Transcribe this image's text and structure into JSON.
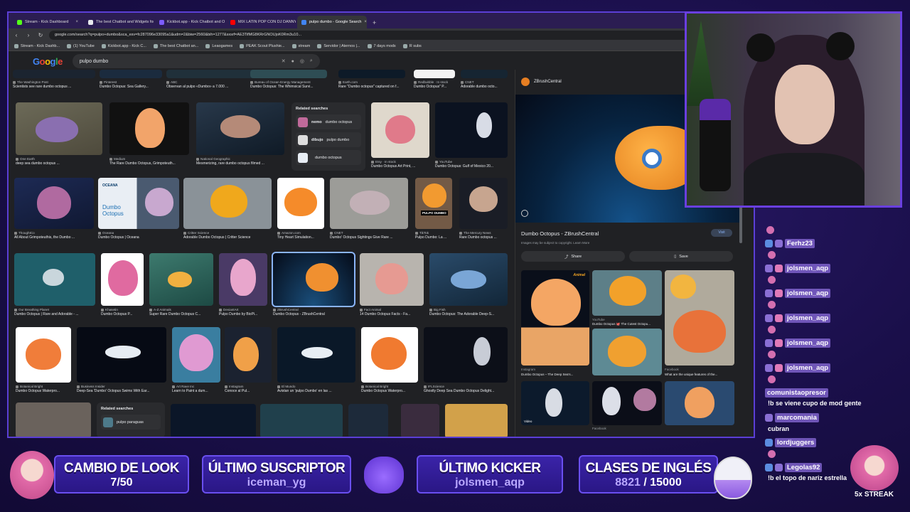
{
  "browser": {
    "tabs": [
      {
        "label": "Stream - Kick Dashboard",
        "color": "#53fc18"
      },
      {
        "label": "The best Chatbot and Widgets for Ki",
        "color": "#e8eaed"
      },
      {
        "label": "Kickbot.app - Kick Chatbot and Overl",
        "color": "#7c5cff"
      },
      {
        "label": "MIX LATIN POP CON DJ DANNY",
        "color": "#ff0000"
      },
      {
        "label": "pulpo dumbo - Google Search",
        "color": "#4285f4",
        "active": true
      }
    ],
    "new_tab": "+",
    "address": "google.com/search?q=pulpo+dumbo&sca_esv=fc287096e33095a1&udm=2&biw=2560&bih=1277&sxsrf=AE3TifMG8KRrGNOUjoK0Rm3u10...",
    "bookmarks": [
      "Stream - Kick Dashb...",
      "(1) YouTube",
      "Kickbot.app - Kick C...",
      "The best Chatbot an...",
      "Leaogames",
      "PEAK Scout Plushie...",
      "stream",
      "Servidor | Aternos |...",
      "7 days mods",
      "R subs"
    ]
  },
  "google": {
    "logo": "Google",
    "query": "pulpo dumbo"
  },
  "results": {
    "row0": [
      {
        "src": "The Washington Post",
        "cap": "Scientists see rare dumbo octopus ..."
      },
      {
        "src": "Pinterest",
        "cap": "Dumbo Octopus: Sea Gallery..."
      },
      {
        "src": "ABC",
        "cap": "Observan al pulpo «Dumbo» a 7.000 ..."
      },
      {
        "src": "Bureau of Ocean Energy Management",
        "cap": "Dumbo Octopus: The Whimsical Survi..."
      },
      {
        "src": "Earth.com",
        "cap": "Rare \"Dumbo octopus\" captured on f..."
      },
      {
        "src": "Redbubble · In stock",
        "cap": "Dumbo Octopus\" P..."
      },
      {
        "src": "CNET",
        "cap": "Adorable dumbo octo..."
      }
    ],
    "row1": [
      {
        "src": "One Earth",
        "cap": "deep sea dumbo octopus ..."
      },
      {
        "src": "Medium",
        "cap": "The Rare Dumbo Octopus, Grimpoteuth..."
      },
      {
        "src": "National Geographic",
        "cap": "Mesmerizing, rare dumbo octopus filmed ..."
      },
      {
        "src": "Etsy · In stock",
        "cap": "Dumbo Octopus Art Print, ..."
      },
      {
        "src": "YouTube",
        "cap": "Dumbo Octopus: Gulf of Mexico 20..."
      }
    ],
    "related1": {
      "header": "Related searches",
      "items": [
        {
          "bold": "nemo",
          "text": " dumbo octopus"
        },
        {
          "bold": "dibujo",
          "text": " pulpo dumbo"
        },
        {
          "bold": "",
          "text": "dumbo octopus"
        }
      ]
    },
    "row2": [
      {
        "src": "ThoughtCo",
        "cap": "All About Grimpoteuthis, the Dumbo ..."
      },
      {
        "src": "Oceana",
        "cap": "Dumbo Octopus | Oceana"
      },
      {
        "src": "Critter Science",
        "cap": "Adorable Dumbo Octopus | Critter Science"
      },
      {
        "src": "Amazon.com",
        "cap": "Tiny Heart Simulation..."
      },
      {
        "src": "CNET",
        "cap": "Dumbo' Octopus Sightings Give Rare ..."
      },
      {
        "src": "TikTok",
        "cap": "Pulpo Dumbo: La ..."
      },
      {
        "src": "The Mercury News",
        "cap": "Rare Dumbo octopus ..."
      }
    ],
    "oceana_label": "OCEANA",
    "oceana_title": "Dumbo Octopus",
    "tiktok_label": "PULPO DUMBO",
    "row3": [
      {
        "src": "Our Breathing Planet",
        "cap": "Dumbo Octopus | Rare and Adorable - ..."
      },
      {
        "src": "Khasetin",
        "cap": "Dumbo Octopus P..."
      },
      {
        "src": "A-Z Animals",
        "cap": "Super Rare Dumbo Octopus C..."
      },
      {
        "src": "DeviantArt",
        "cap": "Pulpo Dumbo by BioPi..."
      },
      {
        "src": "ZBrushCentral",
        "cap": "Dumbo Octopus - ZBrushCentral"
      },
      {
        "src": "Fact Animal",
        "cap": "14 Dumbo Octopus Facts - Fa..."
      },
      {
        "src": "Big Fish",
        "cap": "Dumbo Octopus: The Adorable Deep-S..."
      }
    ],
    "row4": [
      {
        "src": "Botanical Bright",
        "cap": "Dumbo Octopus Waterpro..."
      },
      {
        "src": "Business Insider",
        "cap": "Deep-Sea 'Dumbo' Octopus Swims With Ear..."
      },
      {
        "src": "Art Rave Inc",
        "cap": "Learn to Paint a dum..."
      },
      {
        "src": "Instagram",
        "cap": "Conoce al Pul..."
      },
      {
        "src": "El Mundo",
        "cap": "Avistan un 'pulpo Dumbo' en las ..."
      },
      {
        "src": "Botanical Bright",
        "cap": "Dumbo Octopus Waterpro..."
      },
      {
        "src": "IFLScience",
        "cap": "Ghostly Deep Sea Dumbo Octopus Delight..."
      }
    ],
    "related2": {
      "header": "Related searches",
      "item": "pulpo paraguas"
    }
  },
  "panel": {
    "site": "ZBrushCentral",
    "title": "Dumbo Octopus - ZBrushCentral",
    "note": "Images may be subject to copyright. Learn More",
    "visit": "Visit",
    "share": "Share",
    "save": "Save",
    "thumbs": [
      {
        "src": "Instagram",
        "cap": "Dumbo Octopus – The Deep Sea's..."
      },
      {
        "src": "YouTube",
        "cap": "Dumbo Octopus 🐙 The Cutest Octopu..."
      },
      {
        "src": "Facebook",
        "cap": "What are the unique features of the..."
      },
      {
        "src": "Video",
        "cap": ""
      },
      {
        "src": "Facebook",
        "cap": ""
      }
    ],
    "animal_label": "Animal",
    "video_label": "Video"
  },
  "chat": {
    "messages": [
      {
        "user": "Ferhz23",
        "text": ""
      },
      {
        "user": "jolsmen_aqp",
        "text": ""
      },
      {
        "user": "jolsmen_aqp",
        "text": ""
      },
      {
        "user": "jolsmen_aqp",
        "text": ""
      },
      {
        "user": "jolsmen_aqp",
        "text": ""
      },
      {
        "user": "jolsmen_aqp",
        "text": ""
      },
      {
        "user": "comunistaopresor",
        "text": "!b se viene cupo de mod gente"
      },
      {
        "user": "marcomania",
        "text": "cubran"
      },
      {
        "user": "lordjuggers",
        "text": ""
      },
      {
        "user": "Legolas92",
        "text": "!b el topo de nariz estrella"
      }
    ]
  },
  "overlay": {
    "look_title": "CAMBIO DE LOOK",
    "look_value": "7/50",
    "sub_title": "ÚLTIMO SUSCRIPTOR",
    "sub_value": "iceman_yg",
    "kicker_title": "ÚLTIMO KICKER",
    "kicker_value": "jolsmen_aqp",
    "clases_title": "CLASES DE INGLÉS",
    "clases_current": "8821",
    "clases_sep": " / ",
    "clases_goal": "15000",
    "clases_progress": 0.588,
    "streak": "5x STREAK"
  },
  "colors": {
    "accent": "#6a4ff0",
    "link_blue": "#8ab4f8",
    "dumbo_orange": "#f08a2a"
  }
}
